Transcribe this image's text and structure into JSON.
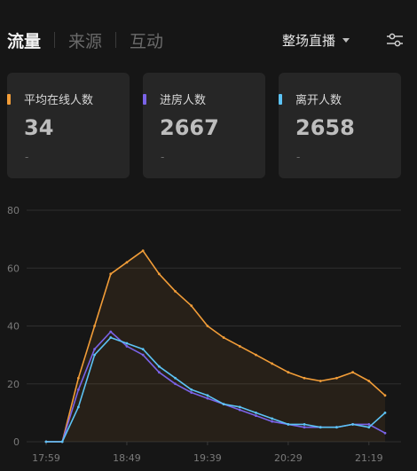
{
  "tabs": [
    {
      "label": "流量",
      "active": true
    },
    {
      "label": "来源",
      "active": false
    },
    {
      "label": "互动",
      "active": false
    }
  ],
  "scope": {
    "label": "整场直播"
  },
  "filter": {
    "icon": "sliders-icon"
  },
  "cards": [
    {
      "label": "平均在线人数",
      "value": "34",
      "sub": "-",
      "color": "#f29d38"
    },
    {
      "label": "进房人数",
      "value": "2667",
      "sub": "-",
      "color": "#7a63e8"
    },
    {
      "label": "离开人数",
      "value": "2658",
      "sub": "-",
      "color": "#5cc3f5"
    }
  ],
  "chart_data": {
    "type": "line",
    "ylim": [
      0,
      80
    ],
    "yticks": [
      0,
      20,
      40,
      60,
      80
    ],
    "xticks": [
      "17:59",
      "18:49",
      "19:39",
      "20:29",
      "21:19"
    ],
    "grid": true,
    "x": [
      "17:59",
      "18:09",
      "18:19",
      "18:29",
      "18:39",
      "18:49",
      "18:59",
      "19:09",
      "19:19",
      "19:29",
      "19:39",
      "19:49",
      "19:59",
      "20:09",
      "20:19",
      "20:29",
      "20:39",
      "20:49",
      "20:59",
      "21:09",
      "21:19",
      "21:29"
    ],
    "series": [
      {
        "color": "#f29d38",
        "values": [
          0,
          0,
          22,
          40,
          58,
          62,
          66,
          58,
          52,
          47,
          40,
          36,
          33,
          30,
          27,
          24,
          22,
          21,
          22,
          24,
          21,
          16
        ]
      },
      {
        "color": "#7a63e8",
        "values": [
          0,
          0,
          18,
          32,
          38,
          33,
          30,
          24,
          20,
          17,
          15,
          13,
          11,
          9,
          7,
          6,
          5,
          5,
          5,
          6,
          6,
          3
        ]
      },
      {
        "color": "#5cc3f5",
        "values": [
          0,
          0,
          12,
          30,
          36,
          34,
          32,
          26,
          22,
          18,
          16,
          13,
          12,
          10,
          8,
          6,
          6,
          5,
          5,
          6,
          5,
          10
        ]
      }
    ]
  }
}
